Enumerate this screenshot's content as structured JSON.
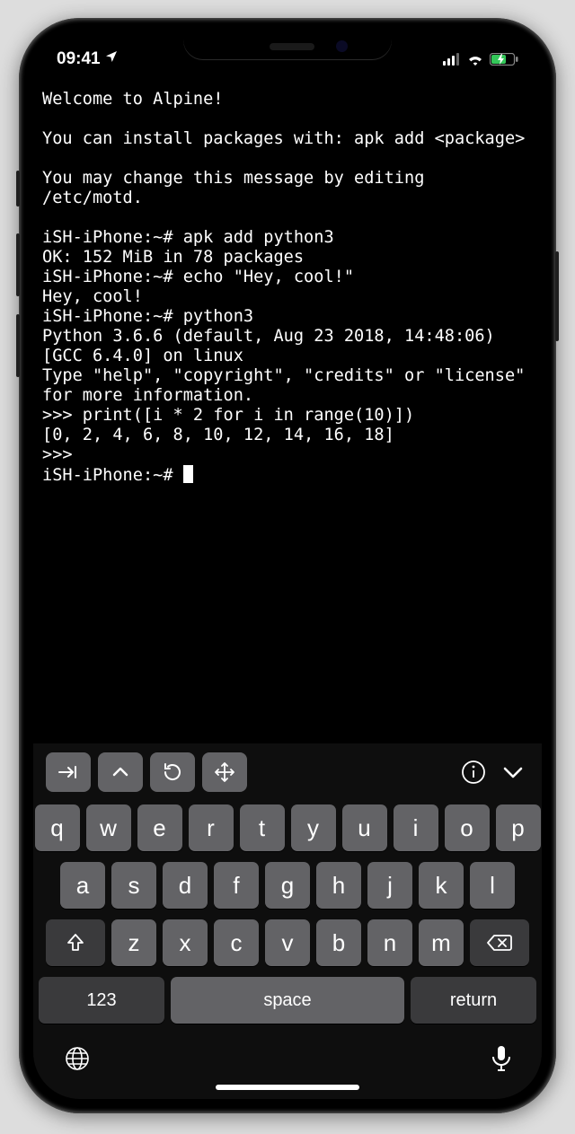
{
  "statusbar": {
    "time": "09:41",
    "location_icon": "location",
    "signal": "signal",
    "wifi": "wifi",
    "battery": "battery-charging"
  },
  "terminal": {
    "lines": [
      "Welcome to Alpine!",
      "",
      "You can install packages with: apk add <package>",
      "",
      "You may change this message by editing /etc/motd.",
      "",
      "iSH-iPhone:~# apk add python3",
      "OK: 152 MiB in 78 packages",
      "iSH-iPhone:~# echo \"Hey, cool!\"",
      "Hey, cool!",
      "iSH-iPhone:~# python3",
      "Python 3.6.6 (default, Aug 23 2018, 14:48:06)",
      "[GCC 6.4.0] on linux",
      "Type \"help\", \"copyright\", \"credits\" or \"license\" for more information.",
      ">>> print([i * 2 for i in range(10)])",
      "[0, 2, 4, 6, 8, 10, 12, 14, 16, 18]",
      ">>>",
      "iSH-iPhone:~# "
    ]
  },
  "accessory": {
    "tab_label": "⇥",
    "up_label": "^",
    "undo_label": "↺",
    "move_label": "✥",
    "info_label": "ⓘ",
    "down_label": "⌄"
  },
  "keyboard": {
    "row1": [
      "q",
      "w",
      "e",
      "r",
      "t",
      "y",
      "u",
      "i",
      "o",
      "p"
    ],
    "row2": [
      "a",
      "s",
      "d",
      "f",
      "g",
      "h",
      "j",
      "k",
      "l"
    ],
    "row3": [
      "z",
      "x",
      "c",
      "v",
      "b",
      "n",
      "m"
    ],
    "shift": "⇧",
    "backspace": "⌫",
    "numbers": "123",
    "space": "space",
    "return": "return",
    "globe": "globe",
    "dictation": "mic"
  }
}
